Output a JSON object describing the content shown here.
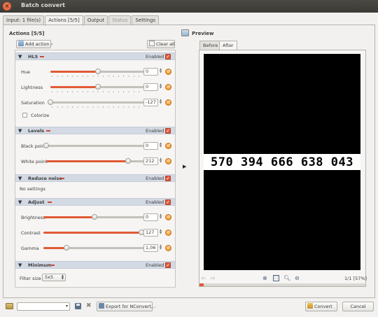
{
  "window": {
    "title": "Batch convert"
  },
  "tabs": [
    {
      "label": "Input: 1 file(s)",
      "active": false,
      "disabled": false
    },
    {
      "label": "Actions [5/5]",
      "active": true,
      "disabled": false
    },
    {
      "label": "Output",
      "active": false,
      "disabled": false
    },
    {
      "label": "Status",
      "active": false,
      "disabled": true
    },
    {
      "label": "Settings",
      "active": false,
      "disabled": false
    }
  ],
  "actions": {
    "title": "Actions [5/5]",
    "add_label": "Add action",
    "clear_label": "Clear all",
    "enabled_label": "Enabled",
    "sections": {
      "hls": {
        "name": "HLS",
        "params": {
          "hue": {
            "label": "Hue",
            "value": "0",
            "level": 0.5
          },
          "lightness": {
            "label": "Lightness",
            "value": "0",
            "level": 0.5
          },
          "saturation": {
            "label": "Saturation",
            "value": "-127",
            "level": 0.0
          }
        },
        "colorize_label": "Colorize"
      },
      "levels": {
        "name": "Levels",
        "params": {
          "black": {
            "label": "Black point",
            "value": "0",
            "level": 0.0
          },
          "white": {
            "label": "White point",
            "value": "212",
            "level": 0.83
          }
        }
      },
      "reduce_noise": {
        "name": "Reduce noise",
        "no_settings": "No settings"
      },
      "adjust": {
        "name": "Adjust",
        "params": {
          "brightness": {
            "label": "Brightness",
            "value": "0",
            "level": 0.5
          },
          "contrast": {
            "label": "Contrast",
            "value": "127",
            "level": 1.0
          },
          "gamma": {
            "label": "Gamma",
            "value": "1,06",
            "level": 0.23
          }
        }
      },
      "minimum": {
        "name": "Minimum",
        "filter_label": "Filter size",
        "filter_value": "5x5"
      }
    }
  },
  "preview": {
    "title": "Preview",
    "tabs": [
      {
        "label": "Before",
        "active": false
      },
      {
        "label": "After",
        "active": true
      }
    ],
    "image_text": "570 394 666 638 043",
    "page_info": "1/1 [57%]"
  },
  "bottom": {
    "export_label": "Export for NConvert...",
    "convert_label": "Convert",
    "cancel_label": "Cancel"
  },
  "colors": {
    "accent": "#e05a35",
    "section_header": "#d3dae4",
    "titlebar": "#3b3a36"
  }
}
